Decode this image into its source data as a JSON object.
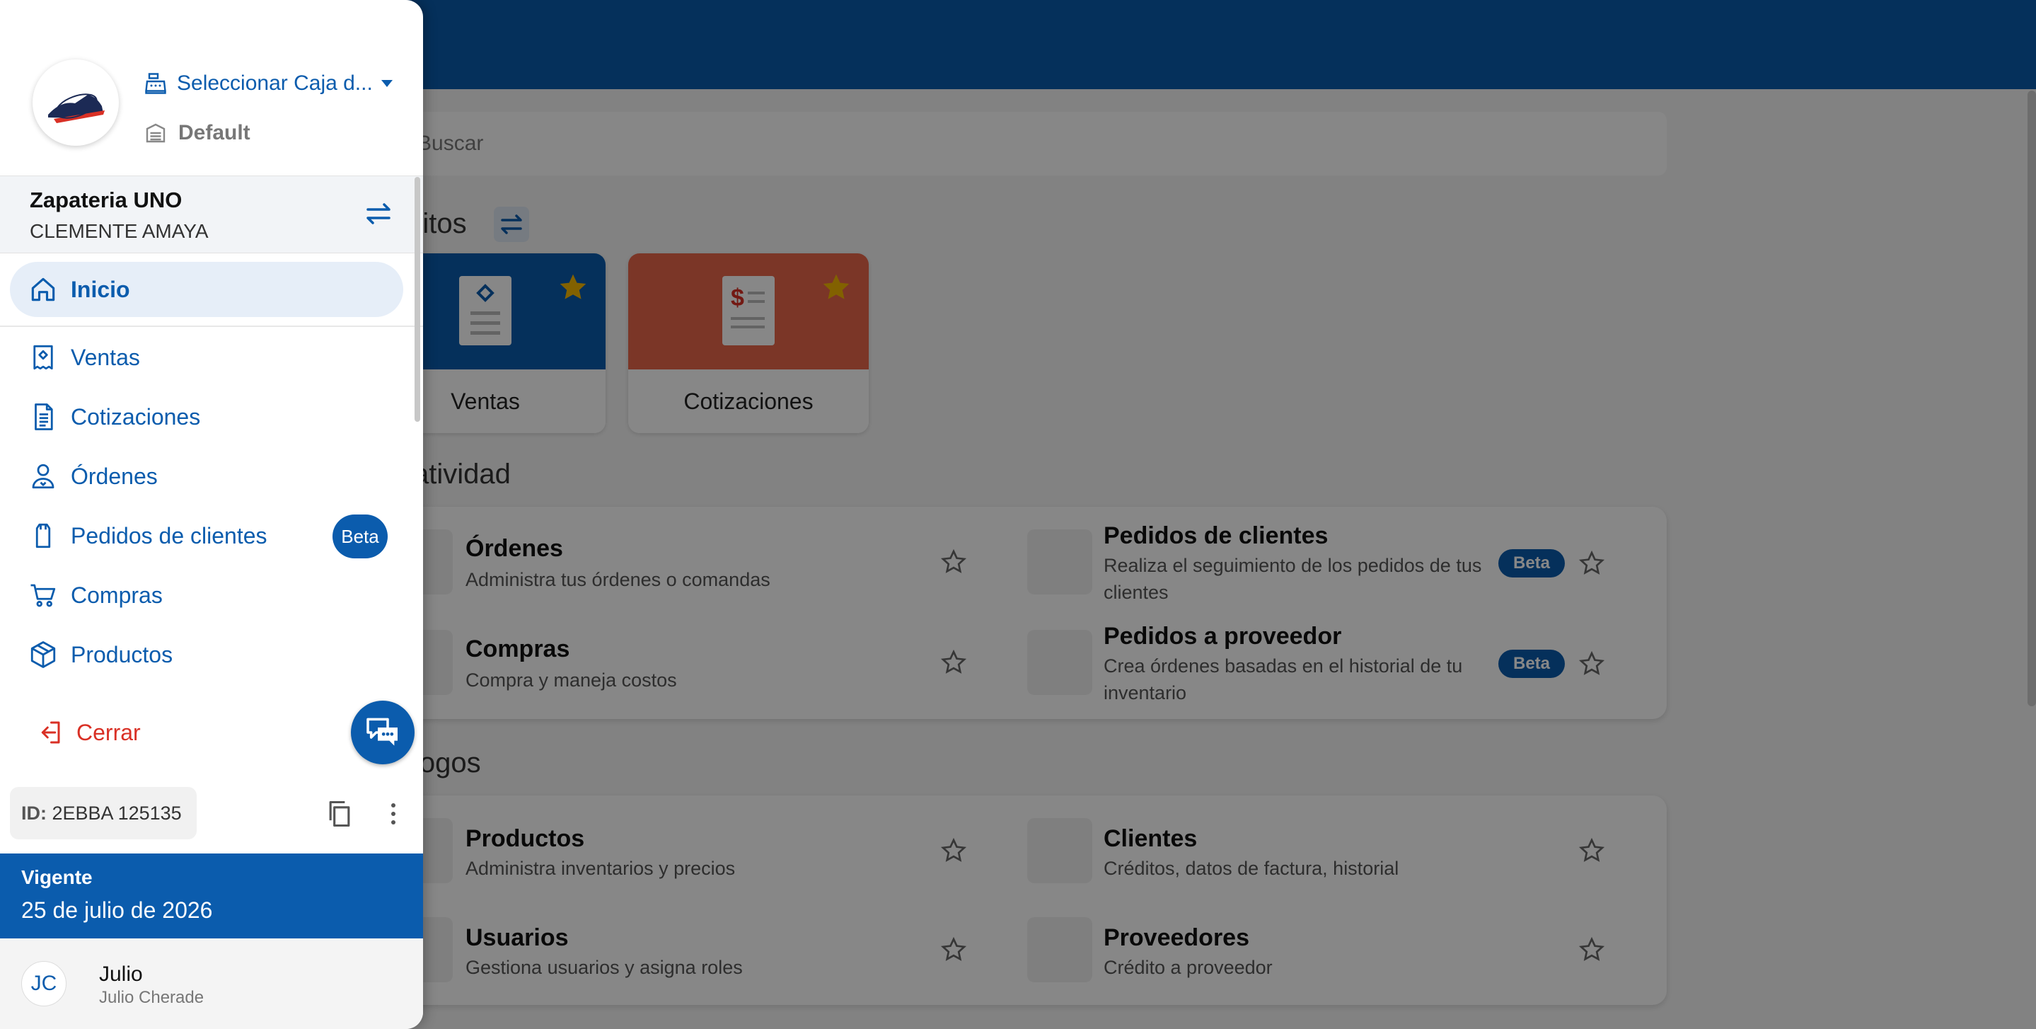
{
  "drawer": {
    "caja_label": "Seleccionar Caja d...",
    "default_label": "Default",
    "business_name": "Zapateria UNO",
    "business_user": "CLEMENTE AMAYA",
    "nav": {
      "inicio": "Inicio",
      "ventas": "Ventas",
      "cotizaciones": "Cotizaciones",
      "ordenes": "Órdenes",
      "pedidos": "Pedidos de clientes",
      "compras": "Compras",
      "productos": "Productos"
    },
    "beta_badge": "Beta",
    "logout_label": "Cerrar",
    "id_label": "ID:",
    "id_value": "2EBBA 125135",
    "status_label": "Vigente",
    "status_date": "25 de julio de 2026",
    "avatar_initials": "JC",
    "user_name": "Julio",
    "user_full_name": "Julio Cherade"
  },
  "background": {
    "search_placeholder": "Buscar",
    "favorites_title": "ritos",
    "favorites": [
      {
        "label": "Ventas",
        "color": "#0b5cad"
      },
      {
        "label": "Cotizaciones",
        "color": "#e8674a"
      }
    ],
    "productividad_title": "atividad",
    "catalogos_title": "logos",
    "productividad_items": [
      {
        "title": "Órdenes",
        "desc": "Administra tus órdenes o comandas"
      },
      {
        "title": "Pedidos de clientes",
        "desc": "Realiza el seguimiento de los pedidos de tus clientes",
        "badge": "Beta"
      },
      {
        "title": "Compras",
        "desc": "Compra y maneja costos"
      },
      {
        "title": "Pedidos a proveedor",
        "desc": "Crea órdenes basadas en el historial de tu inventario",
        "badge": "Beta"
      }
    ],
    "catalogos_items": [
      {
        "title": "Productos",
        "desc": "Administra inventarios y precios"
      },
      {
        "title": "Clientes",
        "desc": "Créditos, datos de factura, historial"
      },
      {
        "title": "Usuarios",
        "desc": "Gestiona usuarios y asigna roles"
      },
      {
        "title": "Proveedores",
        "desc": "Crédito a proveedor"
      }
    ]
  },
  "colors": {
    "primary": "#0b5cad",
    "danger": "#d93025",
    "star": "#f5b800"
  }
}
